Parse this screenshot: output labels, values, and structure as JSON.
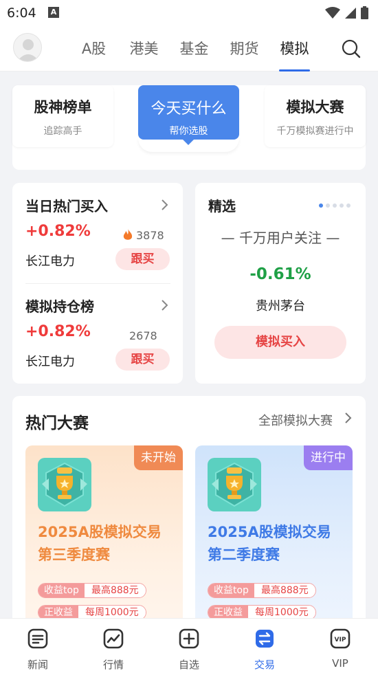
{
  "status_bar": {
    "time": "6:04",
    "notif_icon": "A"
  },
  "top_nav": {
    "tabs": [
      {
        "label": "A股",
        "active": false
      },
      {
        "label": "港美",
        "active": false
      },
      {
        "label": "基金",
        "active": false
      },
      {
        "label": "期货",
        "active": false
      },
      {
        "label": "模拟",
        "active": true
      }
    ]
  },
  "segments": {
    "left": {
      "title": "股神榜单",
      "subtitle": "追踪高手"
    },
    "mid": {
      "title": "今天买什么",
      "subtitle": "帮你选股"
    },
    "right": {
      "title": "模拟大赛",
      "subtitle": "千万模拟赛进行中"
    }
  },
  "hot_buy": {
    "title": "当日热门买入",
    "change": "+0.82%",
    "count": "3878",
    "stock": "长江电力",
    "follow_label": "跟买"
  },
  "position_rank": {
    "title": "模拟持仓榜",
    "change": "+0.82%",
    "count": "2678",
    "stock": "长江电力",
    "follow_label": "跟买"
  },
  "featured": {
    "title": "精选",
    "subtitle": "— 千万用户关注 —",
    "change": "-0.61%",
    "stock": "贵州茅台",
    "buy_label": "模拟买入"
  },
  "contests": {
    "title": "热门大赛",
    "all_link": "全部模拟大赛",
    "items": [
      {
        "status": "未开始",
        "name_line1": "2025A股模拟交易",
        "name_line2": "第三季度赛",
        "tag1_key": "收益top",
        "tag1_val": "最高888元",
        "tag2_key": "正收益",
        "tag2_val": "每周1000元"
      },
      {
        "status": "进行中",
        "name_line1": "2025A股模拟交易",
        "name_line2": "第二季度赛",
        "tag1_key": "收益top",
        "tag1_val": "最高888元",
        "tag2_key": "正收益",
        "tag2_val": "每周1000元"
      }
    ]
  },
  "bottom_nav": [
    {
      "label": "新闻",
      "icon": "news-icon"
    },
    {
      "label": "行情",
      "icon": "market-icon"
    },
    {
      "label": "自选",
      "icon": "watchlist-icon"
    },
    {
      "label": "交易",
      "icon": "trade-icon",
      "active": true
    },
    {
      "label": "VIP",
      "icon": "vip-icon"
    }
  ],
  "colors": {
    "accent": "#2f6be8",
    "up": "#ef3b3b",
    "down": "#1fa046"
  }
}
